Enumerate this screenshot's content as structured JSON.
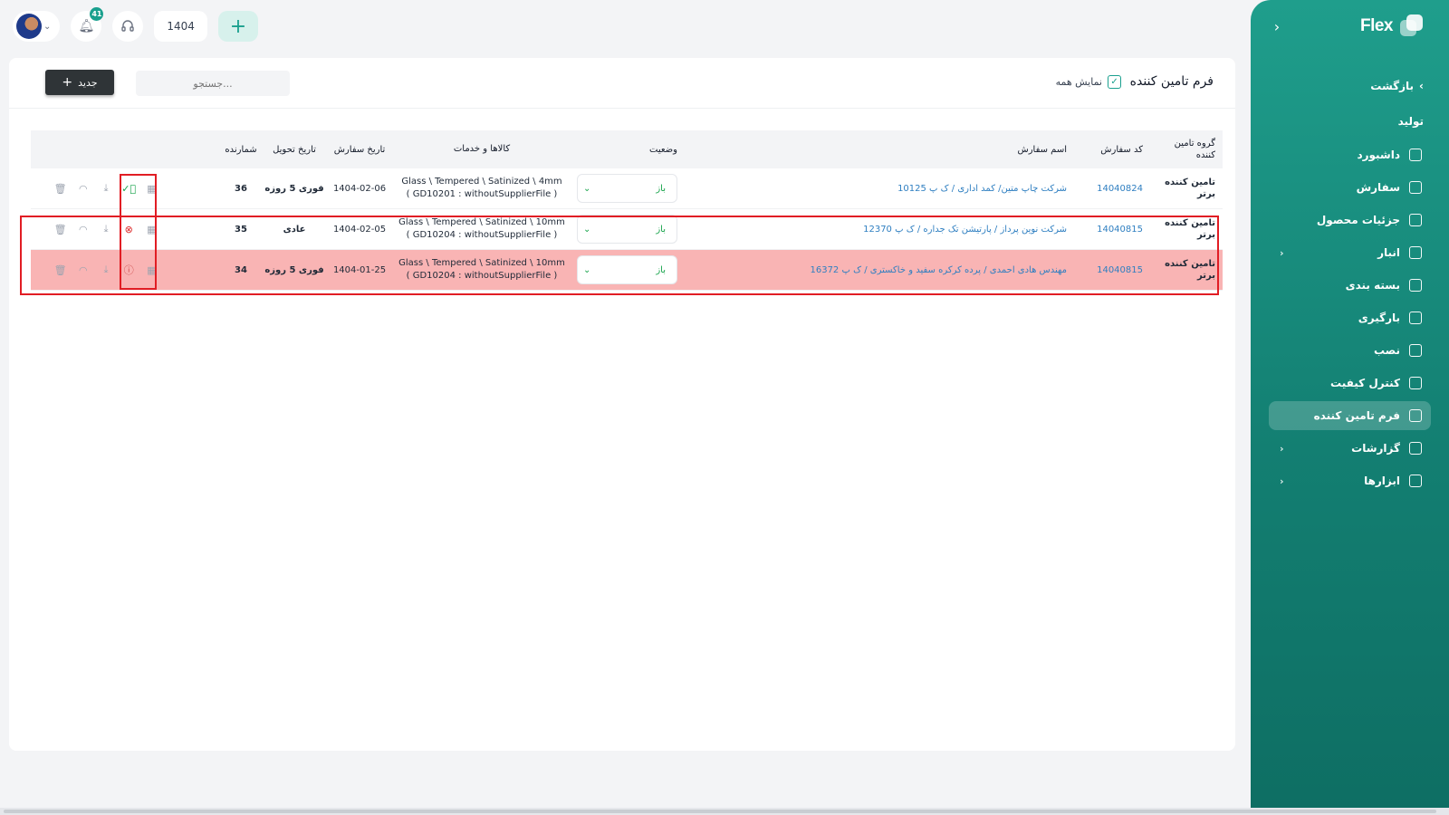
{
  "app": {
    "logo_text": "Flex"
  },
  "sidebar": {
    "back_label": "بازگشت",
    "section_label": "تولید",
    "items": [
      {
        "label": "داشبورد",
        "icon": "home-icon",
        "chevron": false,
        "active": false
      },
      {
        "label": "سفارش",
        "icon": "order-icon",
        "chevron": false,
        "active": false
      },
      {
        "label": "جزئیات محصول",
        "icon": "chart-icon",
        "chevron": false,
        "active": false
      },
      {
        "label": "انبار",
        "icon": "warehouse-icon",
        "chevron": true,
        "active": false
      },
      {
        "label": "بسته بندی",
        "icon": "package-icon",
        "chevron": false,
        "active": false
      },
      {
        "label": "بارگیری",
        "icon": "loading-icon",
        "chevron": false,
        "active": false
      },
      {
        "label": "نصب",
        "icon": "install-icon",
        "chevron": false,
        "active": false
      },
      {
        "label": "کنترل کیفیت",
        "icon": "quality-icon",
        "chevron": false,
        "active": false
      },
      {
        "label": "فرم تامین کننده",
        "icon": "form-icon",
        "chevron": false,
        "active": true
      },
      {
        "label": "گزارشات",
        "icon": "report-icon",
        "chevron": true,
        "active": false
      },
      {
        "label": "ابزارها",
        "icon": "tools-icon",
        "chevron": true,
        "active": false
      }
    ]
  },
  "topbar": {
    "notification_count": "41",
    "year": "1404"
  },
  "header": {
    "title": "فرم تامین کننده",
    "show_all_label": "نمایش همه",
    "search_placeholder": "جستجو...",
    "new_button_label": "جدید"
  },
  "table": {
    "columns": {
      "group": "گروه تامین کننده",
      "code": "کد سفارش",
      "name": "اسم سفارش",
      "status": "وضعیت",
      "goods": "کالاها و خدمات",
      "order_date": "تاریخ سفارش",
      "delivery_date": "تاریخ تحویل",
      "number": "شمارنده"
    },
    "rows": [
      {
        "group": "تامین کننده برتر",
        "code": "14040824",
        "name": "شرکت چاپ متین/ کمد اداری / ک پ 10125",
        "status": "باز",
        "goods_line1": "Glass \\ Tempered \\ Satinized \\ 4mm",
        "goods_line2": "( GD10201 : withoutSupplierFile )",
        "order_date": "1404-02-06",
        "delivery_date": "فوری 5 روزه",
        "number": "36",
        "state": "ok"
      },
      {
        "group": "تامین کننده برتر",
        "code": "14040815",
        "name": "شرکت نوین پرداز / پارتیشن تک جداره / ک پ 12370",
        "status": "باز",
        "goods_line1": "Glass \\ Tempered \\ Satinized \\ 10mm",
        "goods_line2": "( GD10204 : withoutSupplierFile )",
        "order_date": "1404-02-05",
        "delivery_date": "عادی",
        "number": "35",
        "state": "err"
      },
      {
        "group": "تامین کننده برتر",
        "code": "14040815",
        "name": "مهندس هادی احمدی / پرده کرکره سفید و خاکستری / ک پ 16372",
        "status": "باز",
        "goods_line1": "Glass \\ Tempered \\ Satinized \\ 10mm",
        "goods_line2": "( GD10204 : withoutSupplierFile )",
        "order_date": "1404-01-25",
        "delivery_date": "فوری 5 روزه",
        "number": "34",
        "state": "warn"
      }
    ]
  },
  "colors": {
    "brand": "#1aa08e",
    "alert_row": "#f9b4b4",
    "highlight_border": "#e11d24",
    "link": "#2f7fc1"
  }
}
